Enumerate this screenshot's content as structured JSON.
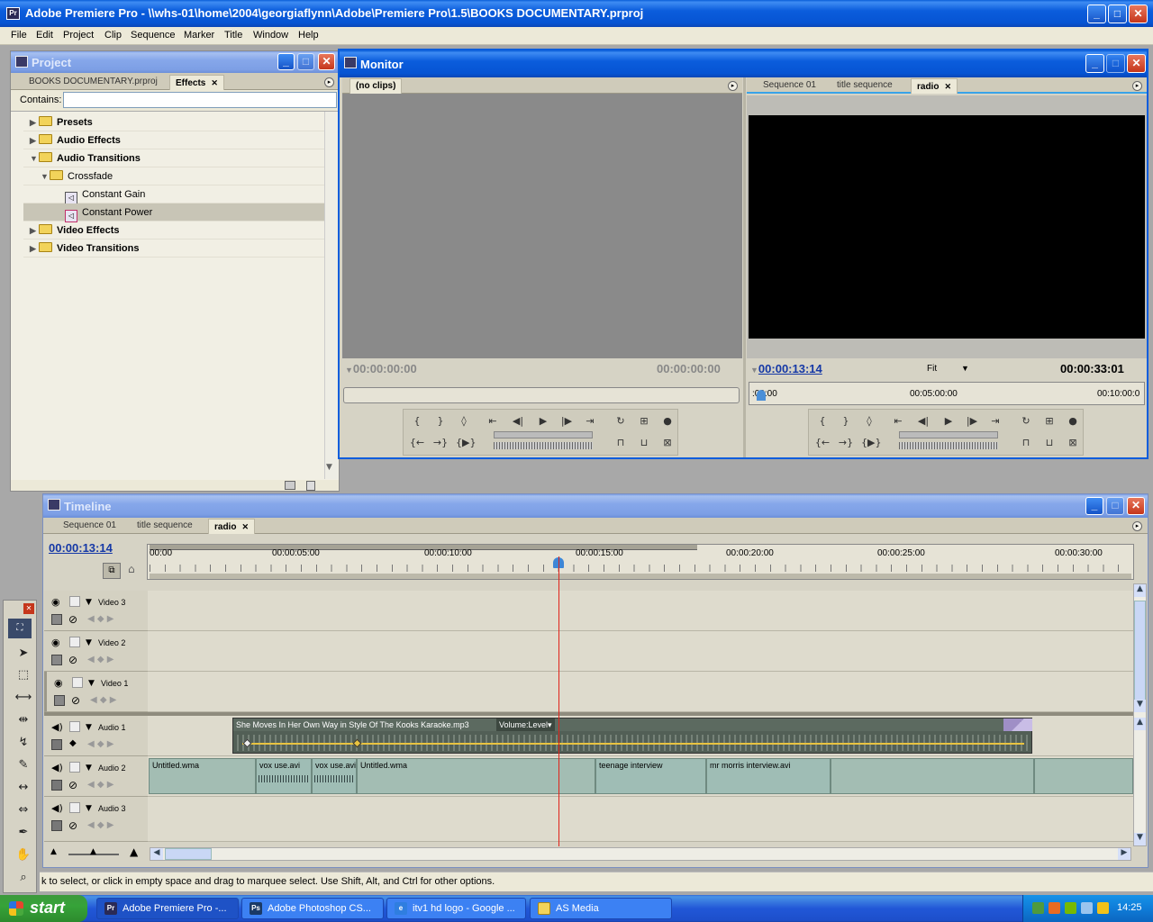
{
  "app": {
    "title": "Adobe Premiere Pro - \\\\whs-01\\home\\2004\\georgiaflynn\\Adobe\\Premiere Pro\\1.5\\BOOKS DOCUMENTARY.prproj",
    "menu": [
      "File",
      "Edit",
      "Project",
      "Clip",
      "Sequence",
      "Marker",
      "Title",
      "Window",
      "Help"
    ]
  },
  "project": {
    "title": "Project",
    "tabs": [
      "BOOKS DOCUMENTARY.prproj",
      "Effects"
    ],
    "contains_label": "Contains:",
    "search_value": "",
    "tree": [
      {
        "label": "Presets",
        "level": 0,
        "kind": "folder",
        "expanded": false
      },
      {
        "label": "Audio Effects",
        "level": 0,
        "kind": "folder",
        "expanded": false
      },
      {
        "label": "Audio Transitions",
        "level": 0,
        "kind": "folder",
        "expanded": true
      },
      {
        "label": "Crossfade",
        "level": 1,
        "kind": "folder",
        "expanded": true
      },
      {
        "label": "Constant Gain",
        "level": 2,
        "kind": "effect"
      },
      {
        "label": "Constant Power",
        "level": 2,
        "kind": "effect",
        "selected": true
      },
      {
        "label": "Video Effects",
        "level": 0,
        "kind": "folder",
        "expanded": false
      },
      {
        "label": "Video Transitions",
        "level": 0,
        "kind": "folder",
        "expanded": false
      }
    ]
  },
  "monitor": {
    "title": "Monitor",
    "source_tab": "(no clips)",
    "source_timecode_left": "00:00:00:00",
    "source_timecode_right": "00:00:00:00",
    "program_tabs": [
      "Sequence 01",
      "title sequence",
      "radio"
    ],
    "program_timecode": "00:00:13:14",
    "program_zoom": "Fit",
    "program_duration": "00:00:33:01",
    "mini_ruler": [
      ":00:00",
      "00:05:00:00",
      "00:10:00:0"
    ]
  },
  "timeline": {
    "title": "Timeline",
    "tabs": [
      "Sequence 01",
      "title sequence",
      "radio"
    ],
    "timecode": "00:00:13:14",
    "ruler": [
      "00:00",
      "00:00:05:00",
      "00:00:10:00",
      "00:00:15:00",
      "00:00:20:00",
      "00:00:25:00",
      "00:00:30:00"
    ],
    "tracks": [
      {
        "name": "Video 3",
        "type": "video"
      },
      {
        "name": "Video 2",
        "type": "video"
      },
      {
        "name": "Video 1",
        "type": "video"
      },
      {
        "name": "Audio 1",
        "type": "audio"
      },
      {
        "name": "Audio 2",
        "type": "audio"
      },
      {
        "name": "Audio 3",
        "type": "audio"
      }
    ],
    "audio1_clip": "She Moves In Her Own Way  in Style Of The Kooks  Karaoke.mp3",
    "audio1_volume": "Volume:Level",
    "audio2_clips": [
      "Untitled.wma",
      "vox use.avi",
      "vox use.avi",
      "Untitled.wma",
      "teenage interview",
      "mr morris interview.avi"
    ]
  },
  "status_bar": "k to select, or click in empty space and drag to marquee select. Use Shift, Alt, and Ctrl for other options.",
  "taskbar": {
    "start": "start",
    "items": [
      "Adobe Premiere Pro -...",
      "Adobe Photoshop CS...",
      "itv1 hd logo - Google ...",
      "AS Media"
    ],
    "clock": "14:25"
  },
  "colors": {
    "xp_blue": "#0b5ddc",
    "audio1_clip": "#525f56",
    "audio2_clip": "#9fbdb5",
    "playhead": "#e0231a",
    "timecode_blue": "#1538a6"
  }
}
